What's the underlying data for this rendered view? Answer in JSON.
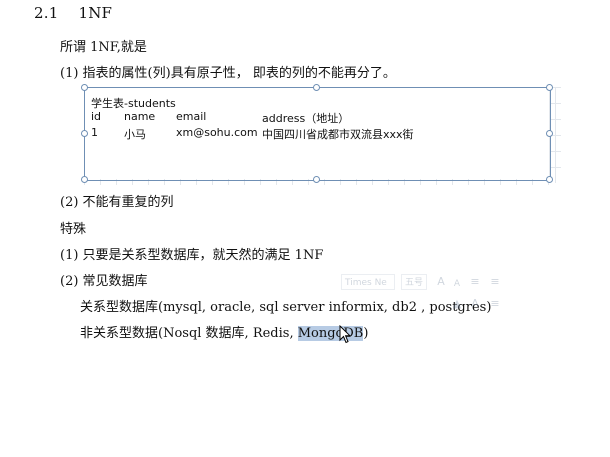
{
  "section": {
    "number": "2.1",
    "title": "1NF"
  },
  "paragraphs": {
    "intro": "所谓 1NF,就是",
    "rule1": "(1) 指表的属性(列)具有原子性， 即表的列的不能再分了。",
    "rule2": "(2) 不能有重复的列",
    "special": "特殊",
    "special1": "(1) 只要是关系型数据库，就天然的满足 1NF",
    "special2": "(2) 常见数据库",
    "relational": "关系型数据库(mysql, oracle, sql server informix, db2 , postgres)",
    "nonrelational_prefix": "非关系型数据(Nosql 数据库, Redis, ",
    "nonrelational_selected": "MongoDB",
    "nonrelational_suffix": ")"
  },
  "embedded_table": {
    "title": "学生表-students",
    "headers": [
      "id",
      "name",
      "email",
      "address（地址）"
    ],
    "rows": [
      [
        "1",
        "小马",
        "xm@sohu.com",
        "中国四川省成都市双流县xxx街"
      ]
    ]
  },
  "mini_toolbar": {
    "font": "Times Ne",
    "size": "五号",
    "icons": [
      "grow-font-icon",
      "shrink-font-icon",
      "indent-icon",
      "outdent-icon",
      "highlight-icon",
      "font-color-icon",
      "format-painter-icon"
    ]
  },
  "colors": {
    "frame": "#6f8fb4",
    "selection": "#b7cbe4"
  }
}
